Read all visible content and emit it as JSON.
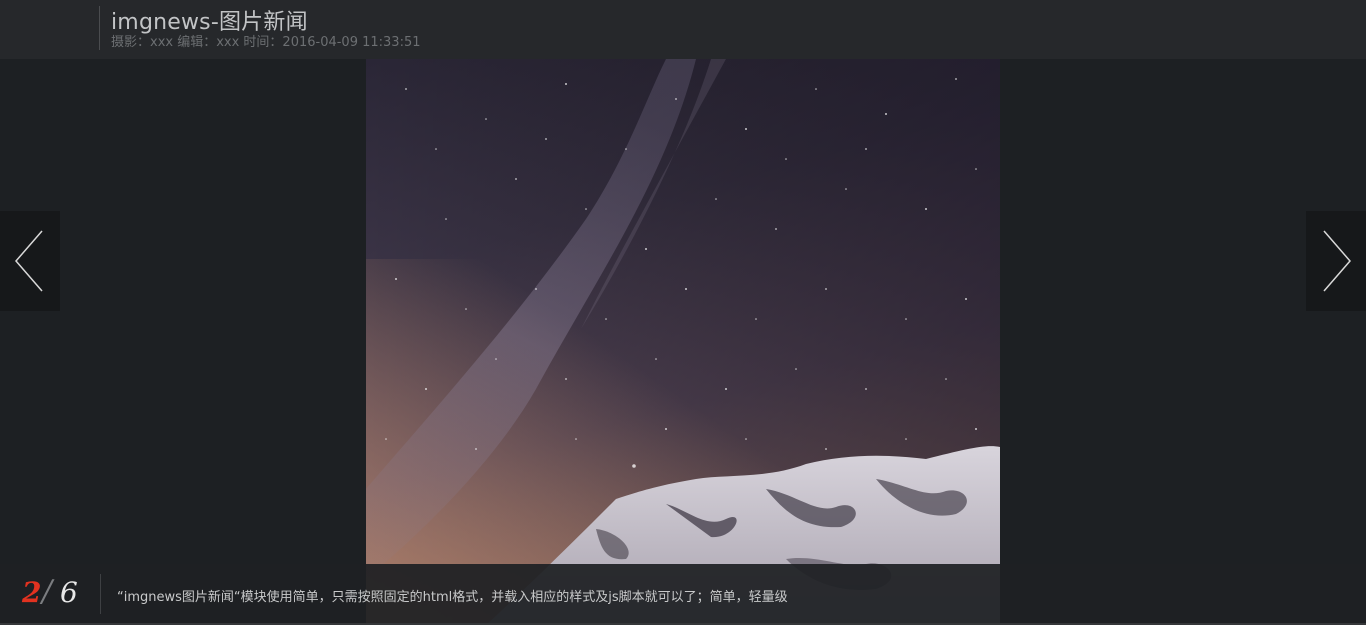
{
  "header": {
    "title": "imgnews-图片新闻",
    "meta": "摄影：xxx  编辑：xxx  时间：2016-04-09 11:33:51"
  },
  "navigation": {
    "prev_icon": "chevron-left-icon",
    "next_icon": "chevron-right-icon"
  },
  "counter": {
    "current": "2",
    "separator": "/",
    "total": "6"
  },
  "caption": {
    "text": "“imgnews图片新闻“模块使用简单，只需按照固定的html格式，并载入相应的样式及js脚本就可以了；简单，轻量级"
  },
  "colors": {
    "background": "#1d2023",
    "header": "#26282b",
    "counter_current": "#e23220",
    "counter_total": "#e8e8e8"
  }
}
